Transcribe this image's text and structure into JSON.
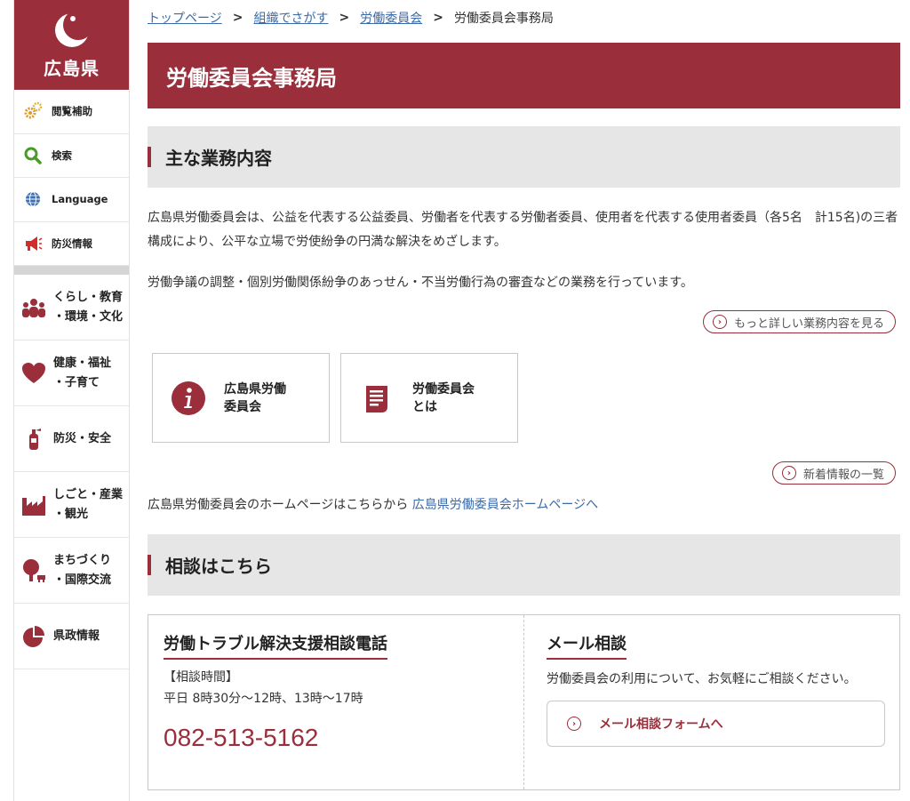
{
  "colors": {
    "brand": "#9a2e3b",
    "link": "#3b6aa8",
    "section_bg": "#e6e6e6"
  },
  "sidebar": {
    "logo_text": "広島県",
    "utility": [
      {
        "label": "閲覧補助",
        "icon": "gear-icon"
      },
      {
        "label": "検索",
        "icon": "search-icon"
      },
      {
        "label": "Language",
        "icon": "globe-icon"
      },
      {
        "label": "防災情報",
        "icon": "megaphone-icon"
      }
    ],
    "categories": [
      {
        "label": "くらし・教育\n・環境・文化",
        "icon": "people-icon"
      },
      {
        "label": "健康・福祉\n・子育て",
        "icon": "heart-icon"
      },
      {
        "label": "防災・安全",
        "icon": "fire-extinguisher-icon"
      },
      {
        "label": "しごと・産業\n・観光",
        "icon": "factory-icon"
      },
      {
        "label": "まちづくり\n・国際交流",
        "icon": "tree-icon"
      },
      {
        "label": "県政情報",
        "icon": "pie-chart-icon"
      }
    ]
  },
  "breadcrumb": {
    "items": [
      "トップページ",
      "組織でさがす",
      "労働委員会"
    ],
    "separator": ">",
    "current": "労働委員会事務局"
  },
  "page_title": "労働委員会事務局",
  "section1": {
    "heading": "主な業務内容",
    "para1": "広島県労働委員会は、公益を代表する公益委員、労働者を代表する労働者委員、使用者を代表する使用者委員（各5名　計15名)の三者構成により、公平な立場で労使紛争の円満な解決をめざします。",
    "para2": "労働争議の調整・個別労働関係紛争のあっせん・不当労働行為の審査などの業務を行っています。",
    "more_button": "もっと詳しい業務内容を見る"
  },
  "cards": [
    {
      "label": "広島県労働\n委員会",
      "icon": "info-icon"
    },
    {
      "label": "労働委員会\nとは",
      "icon": "document-icon"
    }
  ],
  "news_button": "新着情報の一覧",
  "homepage_line": {
    "text": "広島県労働委員会のホームページはこちらから",
    "link": "広島県労働委員会ホームページへ"
  },
  "section2": {
    "heading": "相談はこちら",
    "phone": {
      "title": "労働トラブル解決支援相談電話",
      "hours_label": "【相談時間】",
      "hours": "平日 8時30分～12時、13時～17時",
      "number": "082-513-5162"
    },
    "mail": {
      "title": "メール相談",
      "desc": "労働委員会の利用について、お気軽にご相談ください。",
      "button": "メール相談フォームへ"
    }
  }
}
